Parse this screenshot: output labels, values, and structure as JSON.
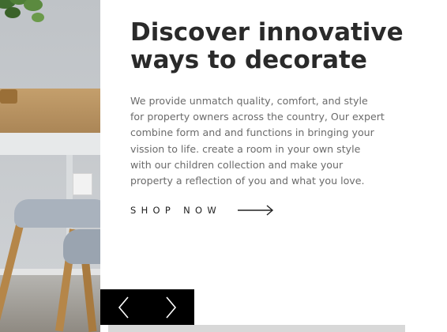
{
  "hero": {
    "heading": "Discover innovative ways to decorate",
    "description": "We provide unmatch quality, comfort, and style for property owners across the country, Our expert combine form and and functions in bringing your vission to life. create a room in your own style with our children collection and make your property a reflection of you and what you love.",
    "cta_label": "SHOP NOW",
    "cta_icon": "arrow-right-icon"
  },
  "slider": {
    "prev_icon": "chevron-left-icon",
    "next_icon": "chevron-right-icon"
  }
}
